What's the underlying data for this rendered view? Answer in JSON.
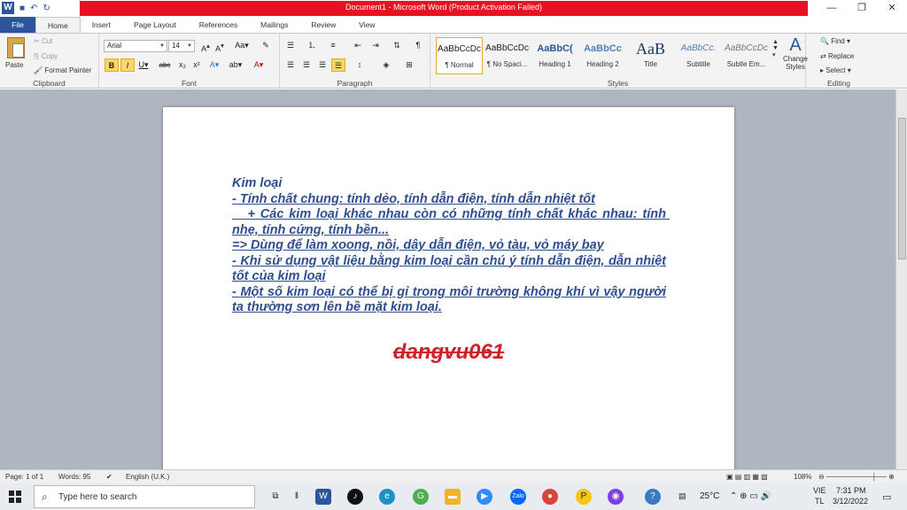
{
  "titlebar": {
    "title": "Document1 - Microsoft Word (Product Activation Failed)",
    "minimize": "—",
    "restore": "❐",
    "close": "✕"
  },
  "tabs": [
    "File",
    "Home",
    "Insert",
    "Page Layout",
    "References",
    "Mailings",
    "Review",
    "View"
  ],
  "clipboard": {
    "paste": "Paste",
    "cut": "Cut",
    "copy": "Copy",
    "format_painter": "Format Painter",
    "label": "Clipboard"
  },
  "font": {
    "name": "Arial",
    "size": "14",
    "label": "Font"
  },
  "paragraph": {
    "label": "Paragraph"
  },
  "styles": {
    "items": [
      {
        "preview": "AaBbCcDc",
        "name": "¶ Normal"
      },
      {
        "preview": "AaBbCcDc",
        "name": "¶ No Spaci..."
      },
      {
        "preview": "AaBbC(",
        "name": "Heading 1"
      },
      {
        "preview": "AaBbCc",
        "name": "Heading 2"
      },
      {
        "preview": "AaB",
        "name": "Title"
      },
      {
        "preview": "AaBbCc.",
        "name": "Subtitle"
      },
      {
        "preview": "AaBbCcDc",
        "name": "Subtle Em..."
      }
    ],
    "change": "Change Styles",
    "label": "Styles"
  },
  "editing": {
    "find": "Find",
    "replace": "Replace",
    "select": "Select",
    "label": "Editing"
  },
  "document": {
    "lines": [
      "Kim loại",
      "- Tính chất chung: tính dẻo, tính dẫn điện, tính dẫn nhiệt tốt",
      "   + Các kim loại khác nhau còn có những tính chất khác nhau: tính nhẹ, tính cứng, tính bền...",
      "=> Dùng để làm xoong, nồi, dây dẫn điện, vỏ tàu, vỏ máy bay",
      "- Khi sử dụng vật liệu bằng kim loại cần chú ý tính dẫn điện, dẫn nhiệt tốt của kim loại",
      "- Một số kim loại có thể bị gỉ trong môi trường không khí vì vậy người ta thường sơn lên bề mặt kim loại."
    ],
    "signature": "dangvu061"
  },
  "status": {
    "page": "Page: 1 of 1",
    "words": "Words: 95",
    "language": "English (U.K.)",
    "zoom": "108%"
  },
  "taskbar": {
    "search_placeholder": "Type here to search",
    "weather": "25°C",
    "lang_top": "VIE",
    "lang_bottom": "TL",
    "time": "7:31 PM",
    "date": "3/12/2022"
  }
}
